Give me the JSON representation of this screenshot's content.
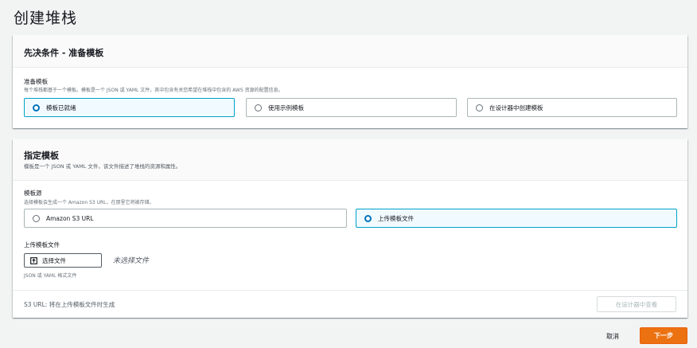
{
  "page_title": "创建堆栈",
  "prereq": {
    "title": "先决条件 - 准备模板",
    "field_label": "准备模板",
    "field_desc": "每个堆栈都基于一个模板。模板是一个 JSON 或 YAML 文件，其中包含有关您希望在堆栈中包含的 AWS 资源的配置信息。",
    "options": [
      {
        "label": "模板已就绪",
        "selected": true
      },
      {
        "label": "使用示例模板",
        "selected": false
      },
      {
        "label": "在设计器中创建模板",
        "selected": false
      }
    ]
  },
  "specify": {
    "title": "指定模板",
    "desc": "模板是一个 JSON 或 YAML 文件，该文件描述了堆栈的资源和属性。",
    "source_label": "模板源",
    "source_desc": "选择模板会生成一个 Amazon S3 URL，在那里它将被存储。",
    "sources": [
      {
        "label": "Amazon S3 URL",
        "selected": false
      },
      {
        "label": "上传模板文件",
        "selected": true
      }
    ],
    "upload_label": "上传模板文件",
    "choose_file": "选择文件",
    "no_file": "未选择文件",
    "file_hint": "JSON 或 YAML 格式文件",
    "s3_url_text": "S3 URL:  将在上传模板文件时生成",
    "view_in_designer": "在设计器中查看"
  },
  "footer": {
    "cancel": "取消",
    "next": "下一步"
  },
  "colors": {
    "accent": "#0073bb",
    "selected_tile_bg": "#f1faff",
    "primary_button": "#ec7211"
  }
}
